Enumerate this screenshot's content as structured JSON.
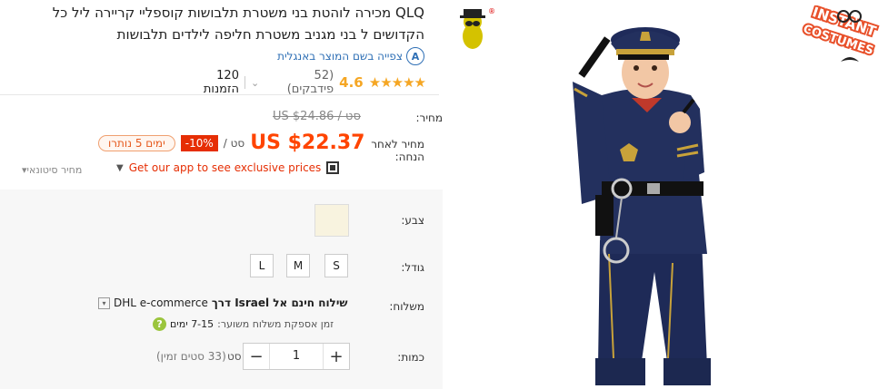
{
  "product": {
    "title": "QLQ מכירה לוהטת בני משטרת תלבושות קוספליי קריירה ליל כל הקדושים ל בני מגניב משטרת חליפה לילדים תלבושות",
    "translate_label": "צפייה בשם המוצר באנגלית",
    "translate_icon_text": "A",
    "rating_value": "4.6",
    "stars": "★★★★★",
    "reviews": "(52 פידבקים)",
    "orders": "120 הזמנות"
  },
  "price": {
    "label": "מחיר:",
    "old": "סט / US $24.86",
    "after_label": "מחיר לאחר הנחה:",
    "new": "US $22.37",
    "per_unit": "/ סט",
    "discount": "-10%",
    "coupon": "ימים 5 נותרו",
    "app_promo": "Get our app to see exclusive prices",
    "wholesale": "מחיר סיטונאי▾"
  },
  "options": {
    "color_label": "צבע:",
    "color_value": "#f8f3df",
    "size_label": "גודל:",
    "sizes": [
      "S",
      "M",
      "L"
    ]
  },
  "shipping": {
    "label": "משלוח:",
    "method_bold": "שילוח חינם אל Israel דרך",
    "carrier": "DHL e-commerce",
    "delivery_label": "זמן אספקת משלוח משוער:",
    "delivery_days": "7-15 ימים",
    "help_icon": "?"
  },
  "quantity": {
    "label": "כמות:",
    "minus": "−",
    "plus": "+",
    "value": "1",
    "unit": "סט",
    "stock": "(33 סטים זמין)"
  },
  "images": {
    "store_logo_text": "INSTANT COSTUMES",
    "mascot_mark": "®"
  }
}
